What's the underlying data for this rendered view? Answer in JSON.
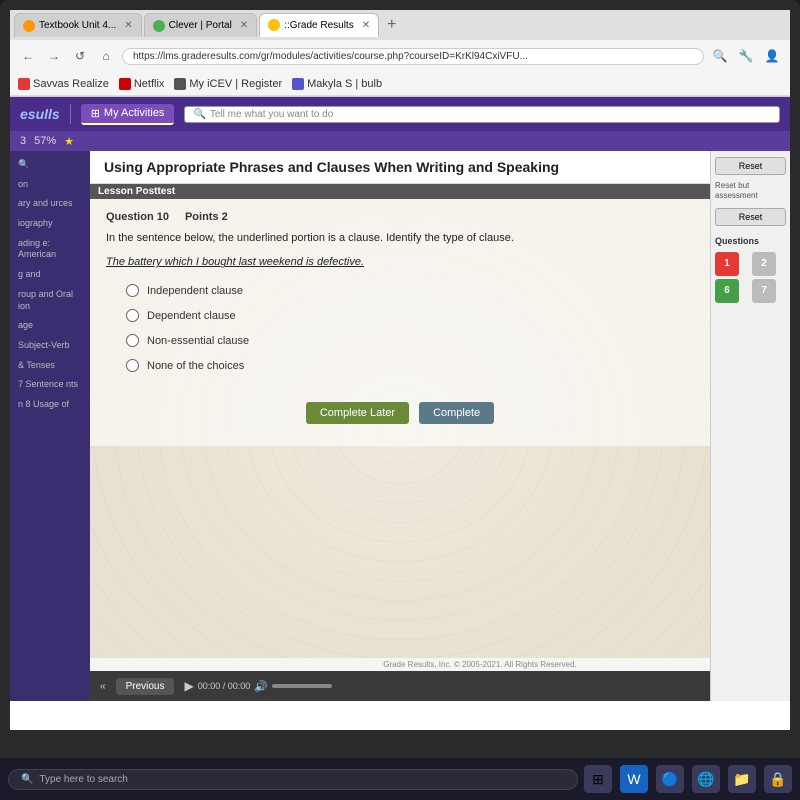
{
  "browser": {
    "tabs": [
      {
        "label": "Textbook Unit 4...",
        "active": false,
        "favicon_color": "orange"
      },
      {
        "label": "Clever | Portal",
        "active": false,
        "favicon_color": "green"
      },
      {
        "label": "::Grade Results",
        "active": true,
        "favicon_color": "yellow"
      }
    ],
    "address": "https://lms.graderesults.com/gr/modules/activities/course.php?courseID=KrKl94CxiVFU...",
    "bookmarks": [
      {
        "label": "Savvas Realize",
        "icon_color": "#e53935"
      },
      {
        "label": "Netflix",
        "icon_color": "#cc0000"
      },
      {
        "label": "My iCEV | Register",
        "icon_color": "#555"
      },
      {
        "label": "Makyla S | bulb",
        "icon_color": "#5555cc"
      }
    ]
  },
  "app_header": {
    "logo": "sulls",
    "nav_items": [
      {
        "label": "My Activities",
        "active": true
      },
      {
        "label": "Tell me what you want to do"
      }
    ]
  },
  "progress": {
    "value": "57%",
    "icon": "★"
  },
  "sidebar": {
    "items": [
      {
        "label": "on"
      },
      {
        "label": "ary and urces"
      },
      {
        "label": "iography"
      },
      {
        "label": "ading e: American"
      },
      {
        "label": "g and"
      },
      {
        "label": "roup and Oral ion"
      },
      {
        "label": "age"
      },
      {
        "label": "Subject-Verb"
      },
      {
        "label": "& Tenses"
      },
      {
        "label": "7 Sentence nts"
      },
      {
        "label": "n 8 Usage of"
      }
    ]
  },
  "lesson": {
    "title": "Using Appropriate Phrases and Clauses When Writing and Speaking",
    "section_label": "Lesson Posttest",
    "question_number": "Question 10",
    "points": "Points 2",
    "question_text": "In the sentence below, the underlined portion is a clause. Identify the type of clause.",
    "underlined_sentence": "The battery which I bought last weekend is defective.",
    "options": [
      {
        "label": "Independent clause"
      },
      {
        "label": "Dependent clause"
      },
      {
        "label": "Non-essential clause"
      },
      {
        "label": "None of the choices"
      }
    ],
    "btn_complete_later": "Complete Later",
    "btn_complete": "Complete"
  },
  "right_panel": {
    "reset_label": "Reset",
    "reset_note": "Reset but assessment",
    "reset_btn2": "Reset",
    "questions_label": "Questions",
    "question_numbers": [
      {
        "num": "1",
        "state": "red"
      },
      {
        "num": "2",
        "state": "gray"
      },
      {
        "num": "6",
        "state": "green"
      },
      {
        "num": "7",
        "state": "gray"
      }
    ]
  },
  "bottom_bar": {
    "prev_label": "Previous",
    "time": "00:00 / 00:00",
    "copyright": "Grade Results, Inc. © 2005-2021. All Rights Reserved."
  },
  "taskbar": {
    "search_placeholder": "Type here to search",
    "icons": [
      "⊞",
      "W",
      "🔵",
      "🌐",
      "📁",
      "🔒"
    ]
  }
}
